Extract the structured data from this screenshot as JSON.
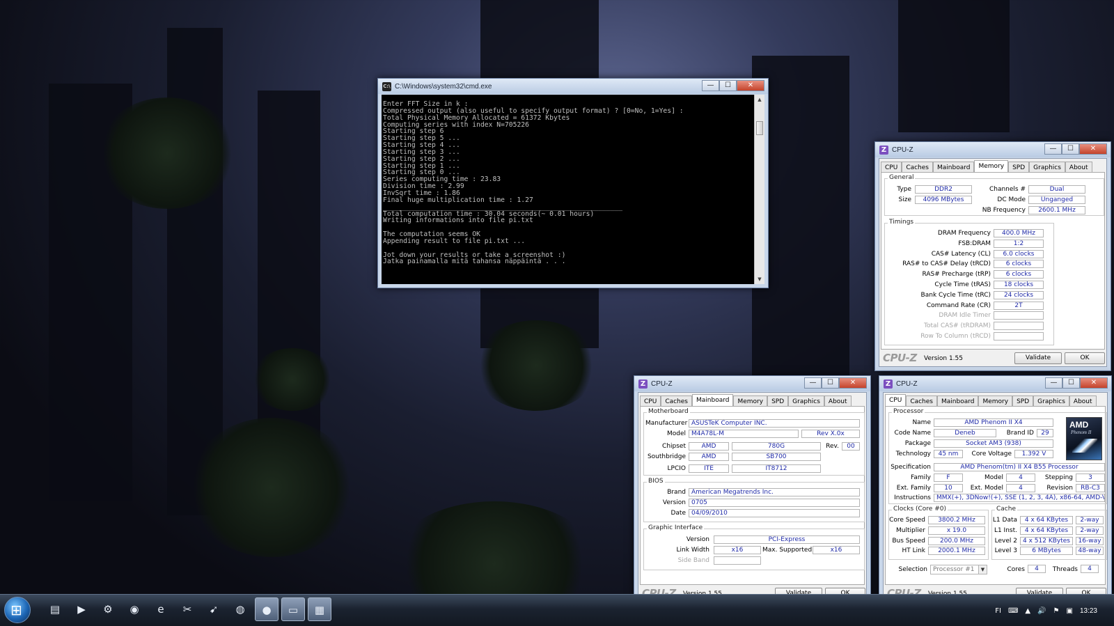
{
  "cmd": {
    "title": "C:\\Windows\\system32\\cmd.exe",
    "output": "Enter FFT Size in k :\nCompressed output (also useful to specify output format) ? [0=No, 1=Yes] :\nTotal Physical Memory Allocated = 61372 Kbytes\nComputing series with index N=705226\nStarting step 6\nStarting step 5 ...\nStarting step 4 ...\nStarting step 3 ...\nStarting step 2 ...\nStarting step 1 ...\nStarting step 0 ...\nSeries computing time : 23.83\nDivision time : 2.99\nInvSqrt time : 1.86\nFinal huge multiplication time : 1.27\n___________________________________________________________\nTotal computation time : 30.04 seconds(~ 0.01 hours)\nWriting informations into file pi.txt\n\nThe computation seems OK\nAppending result to file pi.txt ...\n\nJot down your results or take a screenshot :)\nJatka painamalla mitä tahansa näppäintä . . ."
  },
  "window_buttons": {
    "minimize": "—",
    "maximize": "☐",
    "close": "✕"
  },
  "cpuz_common": {
    "title": "CPU-Z",
    "tabs": [
      "CPU",
      "Caches",
      "Mainboard",
      "Memory",
      "SPD",
      "Graphics",
      "About"
    ],
    "logo": "CPU-Z",
    "version": "Version 1.55",
    "validate": "Validate",
    "ok": "OK"
  },
  "memory": {
    "general_label": "General",
    "type_label": "Type",
    "type": "DDR2",
    "size_label": "Size",
    "size": "4096 MBytes",
    "channels_label": "Channels #",
    "channels": "Dual",
    "dcmode_label": "DC Mode",
    "dcmode": "Unganged",
    "nbfreq_label": "NB Frequency",
    "nbfreq": "2600.1 MHz",
    "timings_label": "Timings",
    "timings": [
      {
        "label": "DRAM Frequency",
        "value": "400.0 MHz",
        "dim": false
      },
      {
        "label": "FSB:DRAM",
        "value": "1:2",
        "dim": false
      },
      {
        "label": "CAS# Latency (CL)",
        "value": "6.0 clocks",
        "dim": false
      },
      {
        "label": "RAS# to CAS# Delay (tRCD)",
        "value": "6 clocks",
        "dim": false
      },
      {
        "label": "RAS# Precharge (tRP)",
        "value": "6 clocks",
        "dim": false
      },
      {
        "label": "Cycle Time (tRAS)",
        "value": "18 clocks",
        "dim": false
      },
      {
        "label": "Bank Cycle Time (tRC)",
        "value": "24 clocks",
        "dim": false
      },
      {
        "label": "Command Rate (CR)",
        "value": "2T",
        "dim": false
      },
      {
        "label": "DRAM Idle Timer",
        "value": "",
        "dim": true
      },
      {
        "label": "Total CAS# (tRDRAM)",
        "value": "",
        "dim": true
      },
      {
        "label": "Row To Column (tRCD)",
        "value": "",
        "dim": true
      }
    ]
  },
  "mainboard": {
    "motherboard_label": "Motherboard",
    "manufacturer_label": "Manufacturer",
    "manufacturer": "ASUSTeK Computer INC.",
    "model_label": "Model",
    "model": "M4A78L-M",
    "model_rev": "Rev X.0x",
    "chipset_label": "Chipset",
    "chipset_vendor": "AMD",
    "chipset_model": "780G",
    "rev_label": "Rev.",
    "chipset_rev": "00",
    "southbridge_label": "Southbridge",
    "sb_vendor": "AMD",
    "sb_model": "SB700",
    "lpcio_label": "LPCIO",
    "lpcio_vendor": "ITE",
    "lpcio_model": "IT8712",
    "bios_label": "BIOS",
    "brand_label": "Brand",
    "brand": "American Megatrends Inc.",
    "version_label": "Version",
    "version": "0705",
    "date_label": "Date",
    "date": "04/09/2010",
    "graphic_label": "Graphic Interface",
    "gi_version_label": "Version",
    "gi_version": "PCI-Express",
    "linkwidth_label": "Link Width",
    "linkwidth": "x16",
    "maxsupported_label": "Max. Supported",
    "maxsupported": "x16",
    "sideband_label": "Side Band",
    "sideband": ""
  },
  "cpu": {
    "processor_label": "Processor",
    "name_label": "Name",
    "name": "AMD Phenom II X4",
    "codename_label": "Code Name",
    "codename": "Deneb",
    "brandid_label": "Brand ID",
    "brandid": "29",
    "package_label": "Package",
    "package": "Socket AM3 (938)",
    "technology_label": "Technology",
    "technology": "45 nm",
    "corevoltage_label": "Core Voltage",
    "corevoltage": "1.392 V",
    "spec_label": "Specification",
    "spec": "AMD Phenom(tm) II X4 B55 Processor",
    "family_label": "Family",
    "family": "F",
    "model_label": "Model",
    "model": "4",
    "stepping_label": "Stepping",
    "stepping": "3",
    "extfamily_label": "Ext. Family",
    "extfamily": "10",
    "extmodel_label": "Ext. Model",
    "extmodel": "4",
    "revision_label": "Revision",
    "revision": "RB-C3",
    "instructions_label": "Instructions",
    "instructions": "MMX(+), 3DNow!(+), SSE (1, 2, 3, 4A), x86-64, AMD-V",
    "logo_text": "AMD",
    "logo_sub": "Phenom II",
    "clocks_label": "Clocks (Core #0)",
    "corespeed_label": "Core Speed",
    "corespeed": "3800.2 MHz",
    "multiplier_label": "Multiplier",
    "multiplier": "x 19.0",
    "busspeed_label": "Bus Speed",
    "busspeed": "200.0 MHz",
    "htlink_label": "HT Link",
    "htlink": "2000.1 MHz",
    "cache_label": "Cache",
    "l1data_label": "L1 Data",
    "l1data": "4 x 64 KBytes",
    "l1data_way": "2-way",
    "l1inst_label": "L1 Inst.",
    "l1inst": "4 x 64 KBytes",
    "l1inst_way": "2-way",
    "level2_label": "Level 2",
    "level2": "4 x 512 KBytes",
    "level2_way": "16-way",
    "level3_label": "Level 3",
    "level3": "6 MBytes",
    "level3_way": "48-way",
    "selection_label": "Selection",
    "selection": "Processor #1",
    "cores_label": "Cores",
    "cores": "4",
    "threads_label": "Threads",
    "threads": "4"
  },
  "taskbar": {
    "start_glyph": "⊞",
    "items": [
      {
        "icon": "folder-icon",
        "glyph": "▤",
        "active": false
      },
      {
        "icon": "media-player-icon",
        "glyph": "▶",
        "active": false
      },
      {
        "icon": "steam-icon",
        "glyph": "⚙",
        "active": false
      },
      {
        "icon": "disc-icon",
        "glyph": "◉",
        "active": false
      },
      {
        "icon": "internet-explorer-icon",
        "glyph": "e",
        "active": false
      },
      {
        "icon": "tools-icon",
        "glyph": "✂",
        "active": false
      },
      {
        "icon": "bird-icon",
        "glyph": "➹",
        "active": false
      },
      {
        "icon": "globe-icon",
        "glyph": "◍",
        "active": false
      },
      {
        "icon": "cpuz-taskbar-icon",
        "glyph": "●",
        "active": true
      },
      {
        "icon": "cmd-taskbar-icon",
        "glyph": "▭",
        "active": true
      },
      {
        "icon": "calculator-icon",
        "glyph": "▦",
        "active": true
      }
    ],
    "language": "FI",
    "clock": "13:23"
  }
}
